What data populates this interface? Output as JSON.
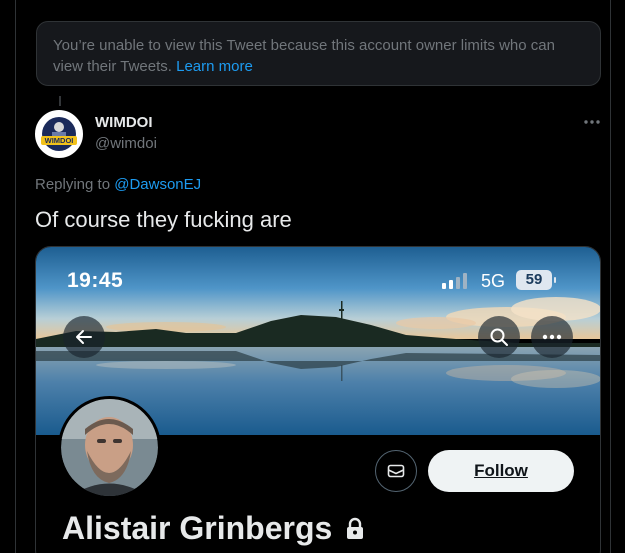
{
  "notice": {
    "text": "You’re unable to view this Tweet because this account owner limits who can view their Tweets.",
    "link": "Learn more"
  },
  "tweet": {
    "author_name": "WIMDOI",
    "author_handle": "@wimdoi",
    "avatar_text": "WIMDOI",
    "replying_to_prefix": "Replying to",
    "replying_to_handle": "@DawsonEJ",
    "text": "Of course they fucking are"
  },
  "media": {
    "status_time": "19:45",
    "network": "5G",
    "battery": "59",
    "follow_label": "Follow",
    "profile_name": "Alistair Grinbergs"
  },
  "icons": [
    "more-icon",
    "back-arrow-icon",
    "search-icon",
    "more-horizontal-icon",
    "mail-icon",
    "lock-icon",
    "signal-icon"
  ],
  "colors": {
    "link": "#1d9bf0",
    "muted": "#71767b",
    "text": "#e7e9ea",
    "bg": "#000000"
  }
}
